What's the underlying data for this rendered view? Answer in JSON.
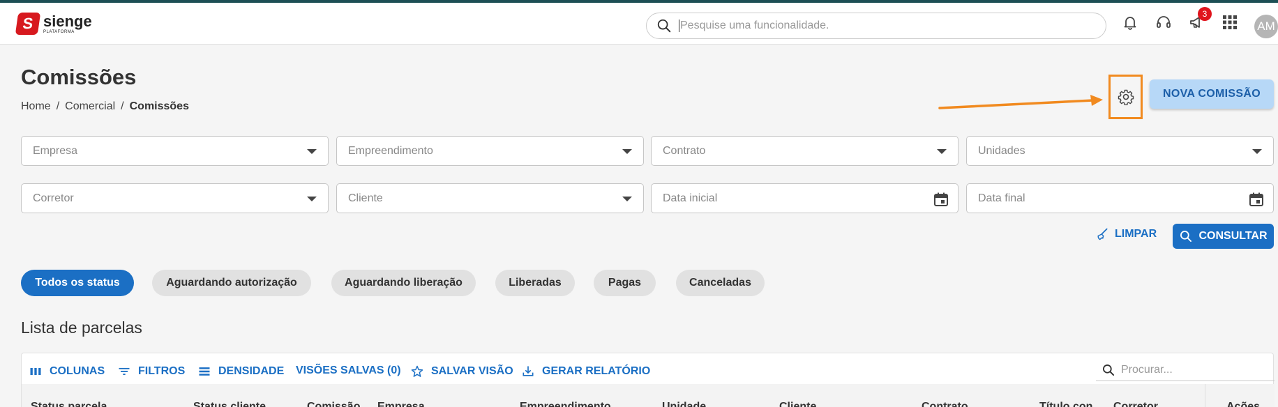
{
  "app": {
    "logo_name": "sienge",
    "logo_sub": "PLATAFORMA",
    "logo_letter": "S"
  },
  "header": {
    "search_placeholder": "Pesquise uma funcionalidade.",
    "notification_count": "3",
    "avatar_initials": "AM"
  },
  "page": {
    "title": "Comissões",
    "breadcrumb": [
      "Home",
      "/",
      "Comercial",
      "/",
      "Comissões"
    ],
    "new_button": "NOVA COMISSÃO"
  },
  "filters": {
    "empresa": "Empresa",
    "empreendimento": "Empreendimento",
    "contrato": "Contrato",
    "unidades": "Unidades",
    "corretor": "Corretor",
    "cliente": "Cliente",
    "data_inicial": "Data inicial",
    "data_final": "Data final",
    "clear_label": "LIMPAR",
    "search_label": "CONSULTAR"
  },
  "status_chips": [
    "Todos os status",
    "Aguardando autorização",
    "Aguardando liberação",
    "Liberadas",
    "Pagas",
    "Canceladas"
  ],
  "list": {
    "title": "Lista de parcelas",
    "toolbar": {
      "columns": "COLUNAS",
      "filters": "FILTROS",
      "density": "DENSIDADE",
      "saved_views": "VISÕES SALVAS (0)",
      "save_view": "SALVAR VISÃO",
      "report": "GERAR RELATÓRIO",
      "search_placeholder": "Procurar..."
    },
    "columns": [
      "Status parcela",
      "Status cliente",
      "Comissão",
      "Empresa",
      "Empreendimento",
      "Unidade",
      "Cliente",
      "Contrato",
      "Título con",
      "Corretor",
      "Ações"
    ]
  },
  "colors": {
    "primary": "#1b6fc4",
    "accent_light": "#b7d8f7",
    "brand_red": "#d7191f",
    "highlight_orange": "#f18a1f",
    "badge_red": "#e0141c"
  }
}
